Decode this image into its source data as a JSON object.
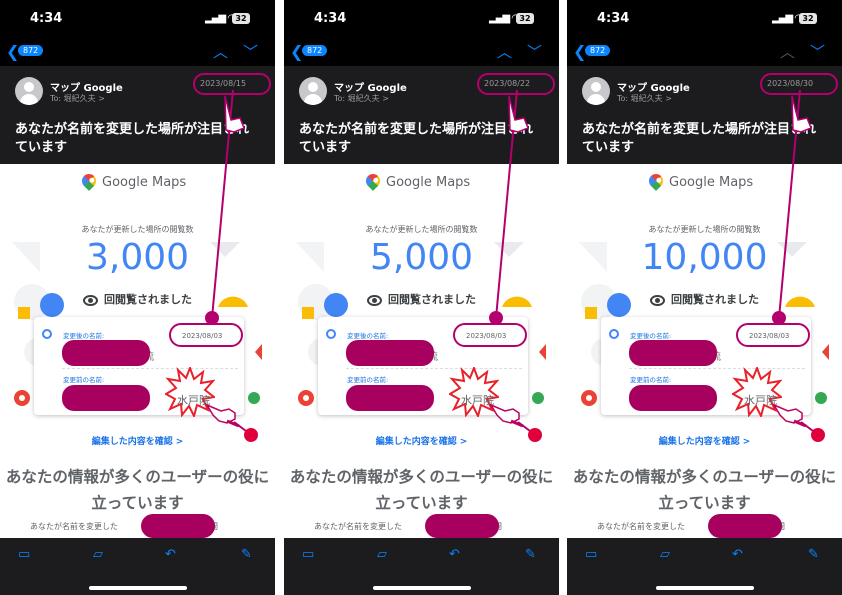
{
  "status_bar": {
    "time": "4:34",
    "battery": "32"
  },
  "nav": {
    "message_count": "872"
  },
  "email": {
    "sender": "マップ Google",
    "to": "To: 堀紀久夫 >",
    "subject": "あなたが名前を変更した場所が注目されています"
  },
  "body": {
    "brand": "Google Maps",
    "views_caption": "あなたが更新した場所の閲覧数",
    "views_text": "回閲覧されました",
    "after_label": "変更後の名前:",
    "before_label": "変更前の名前:",
    "changed_date": "2023/08/03",
    "name_tail": "琉",
    "old_name": "水戸院",
    "cta": "編集した内容を確認",
    "heading": "あなたの情報が多くのユーザーの役に立っています",
    "small_text": "あなたが名前を変更した",
    "small_tail": "の閲"
  },
  "phones": [
    {
      "date": "2023/08/15",
      "views": "3,000",
      "up_disabled": false
    },
    {
      "date": "2023/08/22",
      "views": "5,000",
      "up_disabled": false
    },
    {
      "date": "2023/08/30",
      "views": "10,000",
      "up_disabled": true
    }
  ],
  "colors": {
    "annotation": "#b4006e",
    "redaction": "#a8005f",
    "ios_blue": "#0a84ff",
    "maps_blue": "#4285f4",
    "burst_red": "#e8212a"
  },
  "icons": {
    "back": "chevron-left-icon",
    "up": "chevron-up-icon",
    "down": "chevron-down-icon",
    "archive": "archive-icon",
    "folder": "folder-icon",
    "reply": "reply-icon",
    "compose": "compose-icon"
  }
}
